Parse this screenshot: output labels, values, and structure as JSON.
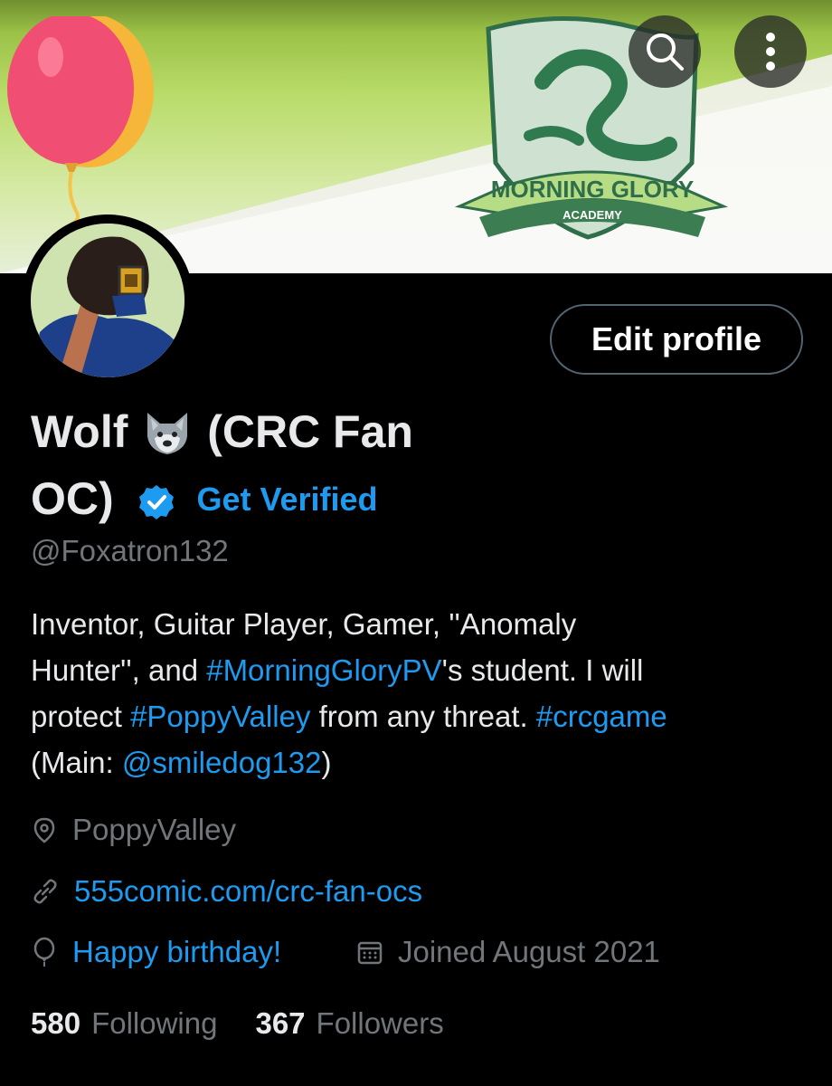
{
  "header": {
    "banner_title": "MORNING GLORY",
    "banner_subtitle": "ACADEMY",
    "search_icon": "search-icon",
    "more_icon": "more-vertical-icon"
  },
  "profile": {
    "edit_label": "Edit profile",
    "name_part1": "Wolf",
    "name_emoji": "wolf-face-emoji",
    "name_part2": "(CRC Fan",
    "name_part3": "OC)",
    "verify_label": "Get Verified",
    "handle": "@Foxatron132",
    "bio": {
      "line1": "Inventor, Guitar Player, Gamer, ''Anomaly",
      "line2_a": "Hunter'', and ",
      "tag1": "#MorningGloryPV",
      "line2_b": "'s student. I will",
      "line3_a": "protect ",
      "tag2": "#PoppyValley",
      "line3_b": " from any threat. ",
      "tag3": "#crcgame",
      "line4_a": "(Main: ",
      "mention": "@smiledog132",
      "line4_b": ")"
    },
    "location": "PoppyValley",
    "website": "555comic.com/crc-fan-ocs",
    "birthday": "Happy birthday!",
    "joined": "Joined August 2021",
    "following_count": "580",
    "following_label": "Following",
    "followers_count": "367",
    "followers_label": "Followers"
  },
  "colors": {
    "accent": "#1d9bf0",
    "muted": "#71767b",
    "text": "#e7e9ea",
    "background": "#000000"
  }
}
